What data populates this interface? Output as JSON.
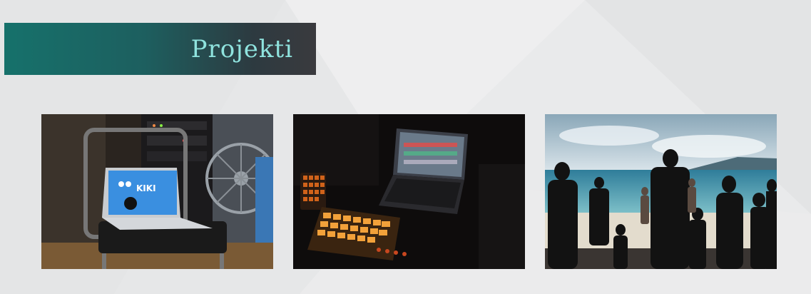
{
  "slide": {
    "title": "Projekti"
  },
  "photos": [
    {
      "icon": "laptop-on-chair-photo",
      "screen_text": "KIKI"
    },
    {
      "icon": "dj-controller-laptop-photo"
    },
    {
      "icon": "beach-projection-silhouettes-photo"
    }
  ],
  "colors": {
    "banner_start": "#16716b",
    "banner_end": "#3a3a3e",
    "title": "#8fe3de",
    "background": "#e9eaeb"
  }
}
